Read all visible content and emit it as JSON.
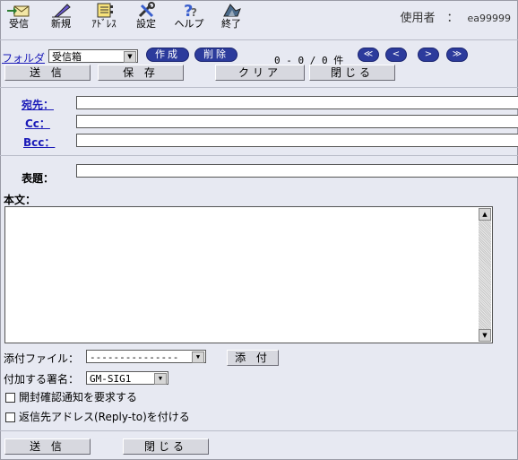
{
  "toolbar": {
    "items": [
      {
        "label": "受信",
        "icon": "receive-mail-icon"
      },
      {
        "label": "新規",
        "icon": "new-pen-icon"
      },
      {
        "label": "ｱﾄﾞﾚｽ",
        "icon": "address-book-icon"
      },
      {
        "label": "設定",
        "icon": "settings-tools-icon"
      },
      {
        "label": "ヘルプ",
        "icon": "help-question-icon"
      },
      {
        "label": "終了",
        "icon": "exit-icon"
      }
    ],
    "user_label": "使用者　：",
    "user_id": "ea99999"
  },
  "folder": {
    "link": "フォルダ",
    "selected": "受信箱",
    "create_button": "作成",
    "delete_button": "削除",
    "counter": "0 - 0 / 0 件"
  },
  "nav": {
    "first": "≪",
    "prev": "<",
    "next": ">",
    "last": "≫"
  },
  "actions_top": {
    "send": "送 信",
    "save": "保 存",
    "clear": "クリア",
    "close": "閉じる"
  },
  "compose": {
    "to_label": "宛先：",
    "cc_label": "Cc：",
    "bcc_label": "Bcc：",
    "subject_label": "表題：",
    "body_label": "本文：",
    "to_value": "",
    "cc_value": "",
    "bcc_value": "",
    "subject_value": "",
    "body_value": ""
  },
  "attachment": {
    "label": "添付ファイル：",
    "selected": "---------------",
    "button": "添 付"
  },
  "signature": {
    "label": "付加する署名：",
    "selected": "GM-SIG1"
  },
  "options": {
    "read_receipt": "開封確認通知を要求する",
    "reply_to": "返信先アドレス(Reply-to)を付ける"
  },
  "actions_bottom": {
    "send": "送 信",
    "close": "閉じる"
  },
  "colors": {
    "background": "#e7e9f2",
    "pill": "#2c3b9c",
    "link": "#1a1ab8",
    "button": "#d7d8df"
  }
}
